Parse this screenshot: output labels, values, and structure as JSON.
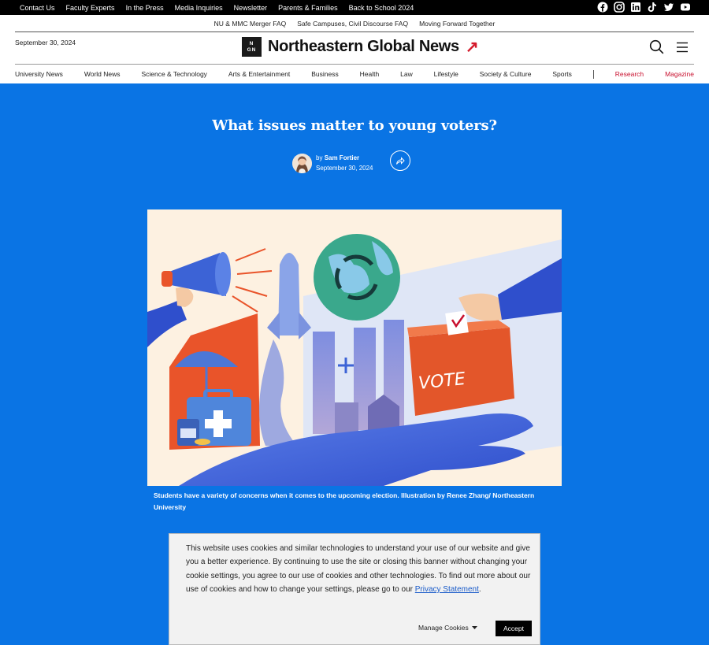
{
  "topbar": {
    "links": [
      "Contact Us",
      "Faculty Experts",
      "In the Press",
      "Media Inquiries",
      "Newsletter",
      "Parents & Families",
      "Back to School 2024"
    ],
    "social_icons": [
      "facebook-icon",
      "instagram-icon",
      "linkedin-icon",
      "tiktok-icon",
      "twitter-icon",
      "youtube-icon"
    ]
  },
  "secondary_nav": [
    "NU & MMC Merger FAQ",
    "Safe Campuses, Civil Discourse FAQ",
    "Moving Forward Together"
  ],
  "header": {
    "date": "September 30, 2024",
    "logo_mark_top": "N",
    "logo_mark_bottom": "GN",
    "site_name": "Northeastern Global News",
    "logo_arrow": "↗"
  },
  "main_nav": {
    "items": [
      "University News",
      "World News",
      "Science & Technology",
      "Arts & Entertainment",
      "Business",
      "Health",
      "Law",
      "Lifestyle",
      "Society & Culture",
      "Sports"
    ],
    "highlight_items": [
      "Research",
      "Magazine"
    ],
    "highlight_color": "#c8102e"
  },
  "article": {
    "title": "What issues matter to young voters?",
    "by_prefix": "by",
    "author": "Sam Fortier",
    "date": "September 30, 2024",
    "caption": "Students have a variety of concerns when it comes to the upcoming election. Illustration by Renee Zhang/ Northeastern University",
    "vote_label": "VOTE"
  },
  "cookie_banner": {
    "text": "This website uses cookies and similar technologies to understand your use of our website and give you a better experience. By continuing to use the site or closing this banner without changing your cookie settings, you agree to our use of cookies and other technologies. To find out more about our use of cookies and how to change your settings, please go to our",
    "link_text": "Privacy Statement",
    "text_end": ".",
    "manage_label": "Manage Cookies",
    "accept_label": "Accept"
  },
  "colors": {
    "background": "#0a74e4",
    "accent_red": "#d41b2c"
  }
}
